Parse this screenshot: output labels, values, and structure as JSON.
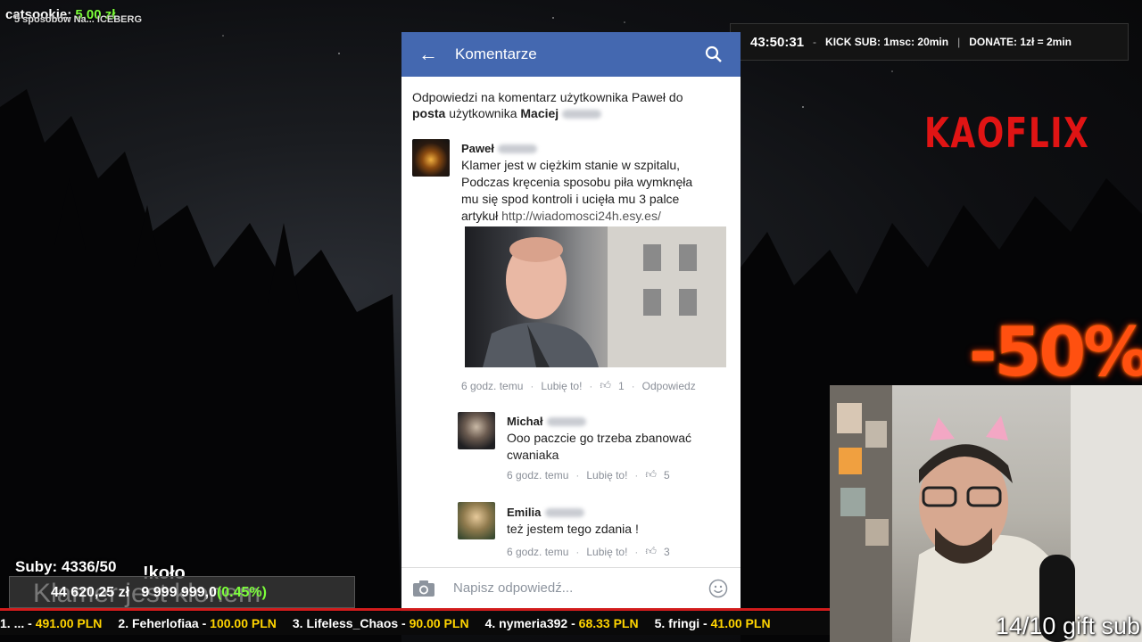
{
  "overlay": {
    "top_left": {
      "user": "catsookie:",
      "amount": "5.00 zł",
      "ghost": "5 sposobów Na... ICEBERG"
    },
    "info_bar": {
      "timer": "43:50:31",
      "kick_sub": "KICK SUB: 1msc: 20min",
      "donate": "DONATE: 1zł = 2min"
    },
    "brand": "KAOFLIX",
    "discount": "-50%",
    "gift_sub": "14/10 gift sub",
    "subs": "Suby: 4336/50",
    "kolo": "!koło",
    "goal_ghost": "Klamer jest klonem",
    "goal_current": "44 620,25 zł",
    "goal_target": "9 999 999,0",
    "goal_percent": "(0.45%)",
    "ticker": [
      {
        "rank": "1",
        "name": "...",
        "amount": "491.00 PLN"
      },
      {
        "rank": "2",
        "name": "Feherlofiaa",
        "amount": "100.00 PLN"
      },
      {
        "rank": "3",
        "name": "Lifeless_Chaos",
        "amount": "90.00 PLN"
      },
      {
        "rank": "4",
        "name": "nymeria392",
        "amount": "68.33 PLN"
      },
      {
        "rank": "5",
        "name": "fringi",
        "amount": "41.00 PLN"
      }
    ],
    "colors": {
      "accent_red": "#e01414",
      "goal_green": "#7cff3a",
      "facebook_blue": "#4468b0"
    }
  },
  "phone": {
    "header": {
      "title": "Komentarze",
      "back_icon": "arrow-left-icon",
      "search_icon": "search-icon"
    },
    "context_line1": "Odpowiedzi na komentarz użytkownika Paweł do",
    "context_bold1": "posta",
    "context_mid": " użytkownika ",
    "context_bold2": "Maciej",
    "comments": [
      {
        "name": "Paweł",
        "text_line1": "Klamer jest w ciężkim stanie w szpitalu,",
        "text_line2": "Podczas kręcenia sposobu piła wymknęła",
        "text_line3": "mu się spod kontroli i ucięła mu 3 palce",
        "text_line4": "artykuł ",
        "link": "http://wiadomosci24h.esy.es/",
        "time": "6 godz. temu",
        "like": "Lubię to!",
        "likes": "1",
        "reply": "Odpowiedz"
      },
      {
        "name": "Michał",
        "text_line1": "Ooo paczcie go trzeba zbanować",
        "text_line2": "cwaniaka",
        "time": "6 godz. temu",
        "like": "Lubię to!",
        "likes": "5"
      },
      {
        "name": "Emilia",
        "text_line1": "też jestem tego zdania !",
        "time": "6 godz. temu",
        "like": "Lubię to!",
        "likes": "3"
      }
    ],
    "composer": {
      "camera_icon": "camera-icon",
      "placeholder": "Napisz odpowiedź...",
      "emoji_icon": "smiley-icon"
    }
  }
}
